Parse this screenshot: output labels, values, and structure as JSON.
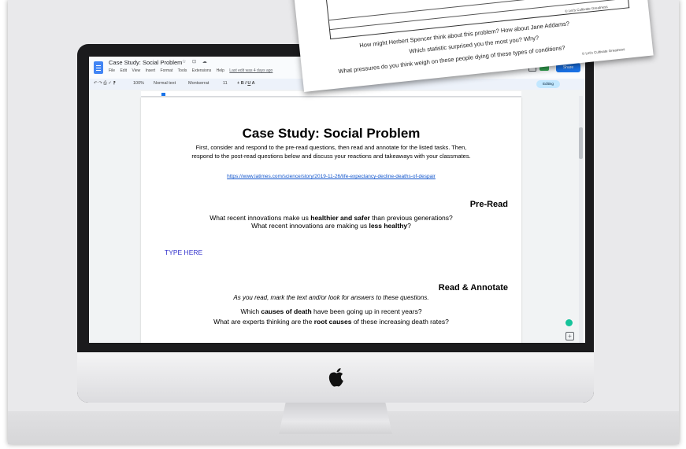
{
  "docs": {
    "title": "Case Study: Social Problem",
    "title_icons": "☆ ⊡ ☁",
    "menus": [
      "File",
      "Edit",
      "View",
      "Insert",
      "Format",
      "Tools",
      "Extensions",
      "Help"
    ],
    "last_edit": "Last edit was 4 days ago",
    "share_label": "Share",
    "editing_label": "Editing",
    "toolbar": {
      "zoom": "100%",
      "style": "Normal text",
      "font": "Montserrat",
      "size": "11"
    }
  },
  "document": {
    "heading": "Case Study: Social Problem",
    "intro_line1": "First, consider and respond to the pre-read questions, then read and annotate for the listed tasks. Then,",
    "intro_line2": "respond to the post-read questions below and discuss your reactions and takeaways with your classmates.",
    "link": "https://www.latimes.com/science/story/2019-11-26/life-expectancy-decline-deaths-of-despair",
    "pre_read": {
      "heading": "Pre-Read",
      "q1_pre": "What recent innovations make us ",
      "q1_bold": "healthier and safer",
      "q1_post": " than previous generations?",
      "q2_pre": "What recent innovations are making us ",
      "q2_bold": "less healthy",
      "q2_post": "?",
      "type_here": "TYPE HERE"
    },
    "read_annotate": {
      "heading": "Read & Annotate",
      "instruction": "As you read, mark the text and/or look for answers to these questions.",
      "q1_pre": "Which ",
      "q1_bold": "causes of death",
      "q1_post": " have been going up in recent years?",
      "q2_pre": "What are experts thinking are the ",
      "q2_bold": "root causes",
      "q2_post": " of these increasing death rates?"
    }
  },
  "worksheet": {
    "q1": "How might Herbert Spencer think about this problem? How about Jane Addams?",
    "q2": "Which statistic surprised you the most you? Why?",
    "q3": "What pressures do you think weigh on these people dying of these types of conditions?",
    "credit1": "© Let's Cultivate Greatness",
    "credit2": "© Let's Cultivate Greatness"
  }
}
